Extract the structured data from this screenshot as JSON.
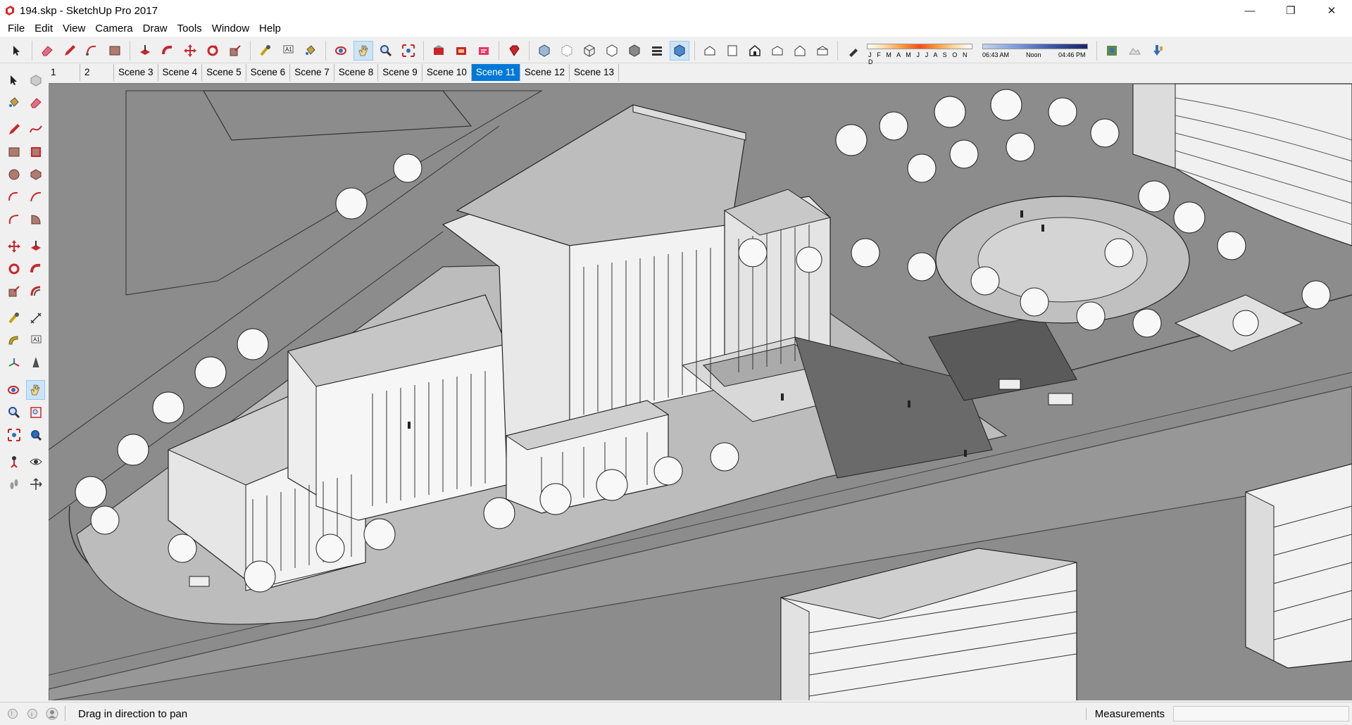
{
  "window": {
    "title": "194.skp - SketchUp Pro 2017",
    "controls": [
      "—",
      "❐",
      "✕"
    ]
  },
  "menu": [
    "File",
    "Edit",
    "View",
    "Camera",
    "Draw",
    "Tools",
    "Window",
    "Help"
  ],
  "toolbar": {
    "shadow_months": "J F M A M J J A S O N D",
    "time_start": "06:43 AM",
    "time_noon": "Noon",
    "time_end": "04:46 PM"
  },
  "scenes": {
    "tabs": [
      "1",
      "2",
      "Scene 3",
      "Scene 4",
      "Scene 5",
      "Scene 6",
      "Scene 7",
      "Scene 8",
      "Scene 9",
      "Scene 10",
      "Scene 11",
      "Scene 12",
      "Scene 13"
    ],
    "active": "Scene 11"
  },
  "status": {
    "message": "Drag in direction to pan",
    "measurements_label": "Measurements",
    "measurements_value": ""
  },
  "colors": {
    "active_tab": "#0078d7",
    "viewport_bg": "#8a8a8a",
    "tool_red": "#c8262c"
  }
}
